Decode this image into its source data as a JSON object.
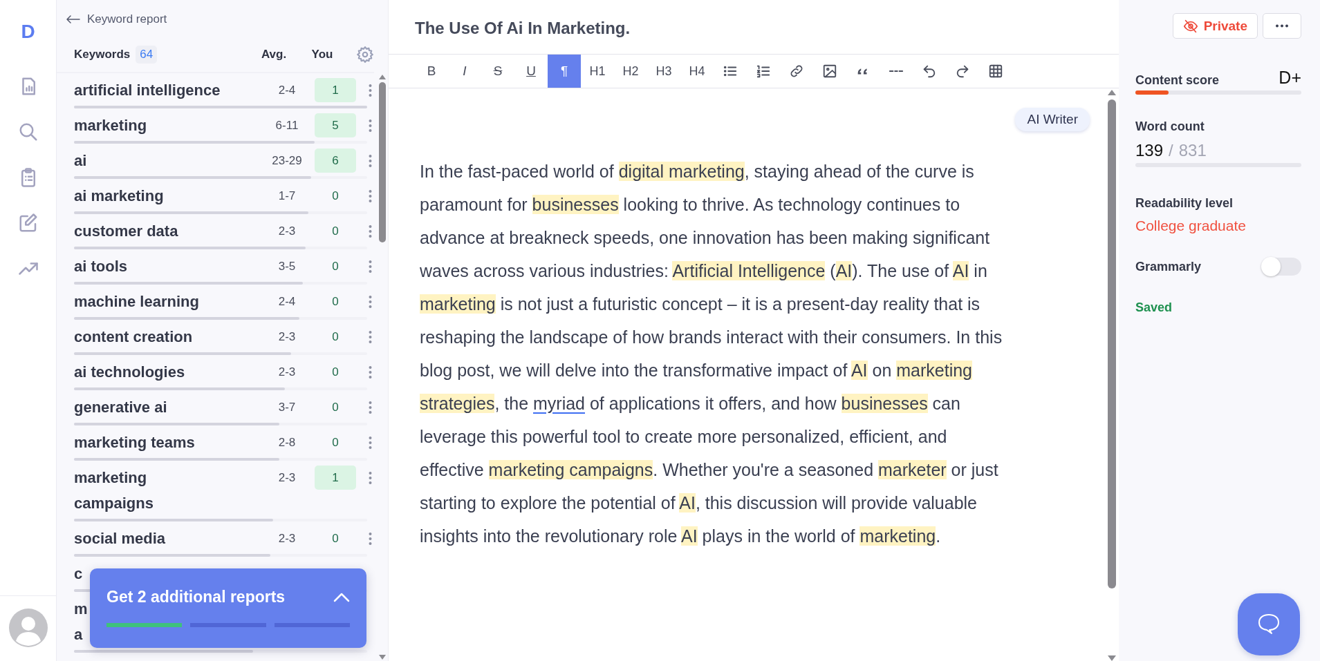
{
  "rail": {
    "logo": "D",
    "items": [
      {
        "kind": "report"
      },
      {
        "kind": "search"
      },
      {
        "kind": "clipboard"
      },
      {
        "kind": "edit"
      },
      {
        "kind": "trend"
      }
    ]
  },
  "keywords": {
    "back_label": "Keyword report",
    "title": "Keywords",
    "count": "64",
    "columns": [
      "Avg.",
      "You"
    ],
    "rows": [
      {
        "keyword": "artificial intelligence",
        "avg": "2-4",
        "you": "1",
        "met": true,
        "level": 1.0
      },
      {
        "keyword": "marketing",
        "avg": "6-11",
        "you": "5",
        "met": true,
        "level": 0.82
      },
      {
        "keyword": "ai",
        "avg": "23-29",
        "you": "6",
        "met": true,
        "level": 0.81
      },
      {
        "keyword": "ai marketing",
        "avg": "1-7",
        "you": "0",
        "met": false,
        "level": 0.8
      },
      {
        "keyword": "customer data",
        "avg": "2-3",
        "you": "0",
        "met": false,
        "level": 0.79
      },
      {
        "keyword": "ai tools",
        "avg": "3-5",
        "you": "0",
        "met": false,
        "level": 0.78
      },
      {
        "keyword": "machine learning",
        "avg": "2-4",
        "you": "0",
        "met": false,
        "level": 0.77
      },
      {
        "keyword": "content creation",
        "avg": "2-3",
        "you": "0",
        "met": false,
        "level": 0.74
      },
      {
        "keyword": "ai technologies",
        "avg": "2-3",
        "you": "0",
        "met": false,
        "level": 0.72
      },
      {
        "keyword": "generative ai",
        "avg": "3-7",
        "you": "0",
        "met": false,
        "level": 0.7
      },
      {
        "keyword": "marketing teams",
        "avg": "2-8",
        "you": "0",
        "met": false,
        "level": 0.7
      },
      {
        "keyword": "marketing campaigns",
        "avg": "2-3",
        "you": "1",
        "met": true,
        "level": 0.68
      },
      {
        "keyword": "social media",
        "avg": "2-3",
        "you": "0",
        "met": false,
        "level": 0.67
      },
      {
        "keyword": "c",
        "level": 0.66
      },
      {
        "keyword": "m a",
        "level": 0.61
      }
    ],
    "promo": {
      "text": "Get 2 additional reports",
      "steps": [
        {
          "done": true
        },
        {
          "done": false
        },
        {
          "done": false
        }
      ]
    }
  },
  "editor": {
    "title": "The Use Of Ai In Marketing.",
    "toolbar": [
      {
        "kind": "bold",
        "label": "B",
        "selected": false
      },
      {
        "kind": "italic",
        "label": "I",
        "selected": false
      },
      {
        "kind": "strike",
        "label": "S",
        "selected": false
      },
      {
        "kind": "underline",
        "label": "U",
        "selected": false
      },
      {
        "kind": "text",
        "label": "¶",
        "selected": true
      },
      {
        "kind": "heading",
        "label": "H1",
        "selected": false
      },
      {
        "kind": "heading",
        "label": "H2",
        "selected": false
      },
      {
        "kind": "heading",
        "label": "H3",
        "selected": false
      },
      {
        "kind": "heading",
        "label": "H4",
        "selected": false
      },
      {
        "kind": "bullets",
        "selected": false
      },
      {
        "kind": "numbered",
        "selected": false
      },
      {
        "kind": "link",
        "selected": false
      },
      {
        "kind": "image",
        "selected": false
      },
      {
        "kind": "quote",
        "selected": false
      },
      {
        "kind": "rule",
        "selected": false
      },
      {
        "kind": "undo",
        "selected": false
      },
      {
        "kind": "redo",
        "selected": false
      },
      {
        "kind": "table",
        "selected": false
      }
    ],
    "ai_writer": "AI Writer",
    "paragraph": [
      {
        "kind": "plain",
        "text": "In the fast-paced world of "
      },
      {
        "kind": "highlight",
        "text": "digital marketing"
      },
      {
        "kind": "plain",
        "text": ", staying ahead of the curve is paramount for "
      },
      {
        "kind": "highlight",
        "text": "businesses"
      },
      {
        "kind": "plain",
        "text": " looking to thrive. As technology continues to advance at breakneck speeds, one innovation has been making significant waves across various industries: "
      },
      {
        "kind": "highlight",
        "text": "Artificial Intelligence"
      },
      {
        "kind": "plain",
        "text": " ("
      },
      {
        "kind": "highlight",
        "text": "AI"
      },
      {
        "kind": "plain",
        "text": "). The use of "
      },
      {
        "kind": "highlight",
        "text": "AI"
      },
      {
        "kind": "plain",
        "text": " in "
      },
      {
        "kind": "highlight",
        "text": "marketing"
      },
      {
        "kind": "plain",
        "text": " is not just a futuristic concept – it is a present-day reality that is reshaping the landscape of how brands interact with their consumers. In this blog post, we will delve into the transformative impact of "
      },
      {
        "kind": "highlight",
        "text": "AI"
      },
      {
        "kind": "plain",
        "text": " on "
      },
      {
        "kind": "highlight",
        "text": "marketing strategies"
      },
      {
        "kind": "plain",
        "text": ", the "
      },
      {
        "kind": "flagged",
        "text": "myriad"
      },
      {
        "kind": "plain",
        "text": " of applications it offers, and how "
      },
      {
        "kind": "highlight",
        "text": "businesses"
      },
      {
        "kind": "plain",
        "text": " can leverage this powerful tool to create more personalized, efficient, and effective "
      },
      {
        "kind": "highlight",
        "text": "marketing campaigns"
      },
      {
        "kind": "plain",
        "text": ". Whether you're a seasoned "
      },
      {
        "kind": "highlight",
        "text": "marketer"
      },
      {
        "kind": "plain",
        "text": " or just starting to explore the potential of "
      },
      {
        "kind": "highlight",
        "text": "AI"
      },
      {
        "kind": "plain",
        "text": ", this discussion will provide valuable insights into the revolutionary role "
      },
      {
        "kind": "highlight",
        "text": "AI"
      },
      {
        "kind": "plain",
        "text": " plays in the world of "
      },
      {
        "kind": "highlight",
        "text": "marketing"
      },
      {
        "kind": "plain",
        "text": "."
      }
    ]
  },
  "side": {
    "private_label": "Private",
    "content_score": {
      "label": "Content score",
      "grade": "D+",
      "level": 0.2
    },
    "word_count": {
      "label": "Word count",
      "count": "139",
      "separator": "/",
      "target": "831",
      "level": 0
    },
    "readability": {
      "label": "Readability level",
      "value": "College graduate"
    },
    "grammarly": {
      "label": "Grammarly",
      "on": false
    },
    "status": "Saved"
  }
}
